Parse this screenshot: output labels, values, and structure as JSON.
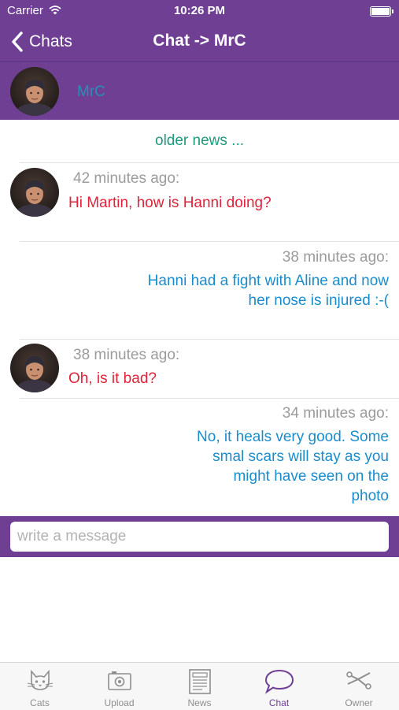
{
  "status_bar": {
    "carrier": "Carrier",
    "time": "10:26 PM"
  },
  "nav": {
    "back_label": "Chats",
    "title": "Chat -> MrC"
  },
  "contact": {
    "name": "MrC"
  },
  "older_news_label": "older news ...",
  "messages": [
    {
      "direction": "incoming",
      "time": "42 minutes ago:",
      "text": "Hi Martin, how is Hanni doing?"
    },
    {
      "direction": "outgoing",
      "time": "38 minutes ago:",
      "text": "Hanni had a fight with Aline and now her nose is injured :-("
    },
    {
      "direction": "incoming",
      "time": "38 minutes ago:",
      "text": "Oh, is it bad?"
    },
    {
      "direction": "outgoing",
      "time": "34 minutes ago:",
      "text": "No, it heals very good. Some smal scars will stay as you might have seen on the photo"
    }
  ],
  "composer": {
    "placeholder": "write a message",
    "value": ""
  },
  "tabs": [
    {
      "label": "Cats",
      "icon": "cat-icon",
      "active": false
    },
    {
      "label": "Upload",
      "icon": "camera-icon",
      "active": false
    },
    {
      "label": "News",
      "icon": "newspaper-icon",
      "active": false
    },
    {
      "label": "Chat",
      "icon": "chat-bubble-icon",
      "active": true
    },
    {
      "label": "Owner",
      "icon": "owner-icon",
      "active": false
    }
  ],
  "colors": {
    "brand_purple": "#6f3f94",
    "incoming_text": "#e0223a",
    "outgoing_text": "#1a8ccc",
    "older_news": "#1f9a7a",
    "contact_name": "#2a8fb8"
  }
}
